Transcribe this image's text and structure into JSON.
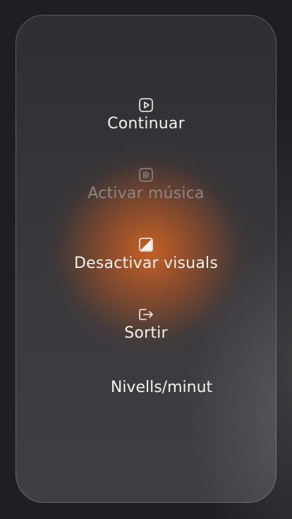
{
  "menu": {
    "continue": {
      "label": "Continuar",
      "icon": "play-icon"
    },
    "music": {
      "label": "Activar música",
      "icon": "music-bars-icon",
      "enabled": false
    },
    "visuals": {
      "label": "Desactivar visuals",
      "icon": "contrast-icon"
    },
    "exit": {
      "label": "Sortir",
      "icon": "exit-icon"
    }
  },
  "rate_label": "Nivells/minut",
  "colors": {
    "accent": "#cd6224",
    "text": "#f4f1ee",
    "disabled_text": "#8c8787",
    "panel": "#353438",
    "background": "#1f1e22"
  }
}
